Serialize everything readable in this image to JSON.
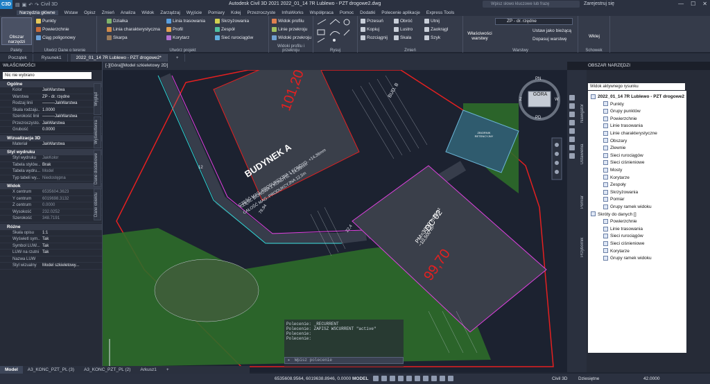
{
  "titlebar": {
    "app_icon_label": "C3D",
    "workspace": "Civil 3D",
    "title": "Autodesk Civil 3D 2021   2022_01_14 7R Lublewo - PZT drogowe2.dwg",
    "search_placeholder": "Wpisz słowo kluczowe lub frazę",
    "user": "Zarejestruj się",
    "min": "—",
    "max": "☐",
    "close": "✕"
  },
  "menu": [
    "Narzędzia główne",
    "Wstaw",
    "Opisz",
    "Zmień",
    "Analiza",
    "Widok",
    "Zarządzaj",
    "Wyjście",
    "Pomiary",
    "Kolej",
    "Przezroczyste",
    "InfraWorks",
    "Współpraca",
    "Pomoc",
    "Dodatki",
    "Polecenie aplikacje",
    "Express Tools"
  ],
  "ribbon": {
    "palettes": {
      "big": "Obszar narzędzi",
      "label": "Palety"
    },
    "ground": {
      "items": [
        "Punkty",
        "Powierzchnie",
        "Ciąg poligonowy"
      ],
      "label": "Utwórz Dane o terenie"
    },
    "design": {
      "items": [
        "Działka",
        "Linia charakterystyczna",
        "Skarpa",
        "Linia trasowania",
        "Profil",
        "Korytarz",
        "Skrzyżowania",
        "Zespół",
        "Sieć rurociągów"
      ],
      "label": "Utwórz projekt"
    },
    "profile": {
      "items": [
        "Widok profilu",
        "Linie przekroju",
        "Widoki przekroju"
      ],
      "label": "Widoki profilu i przekroju"
    },
    "draw": {
      "label": "Rysuj"
    },
    "modify": {
      "items": [
        "Przesuń",
        "Kopiuj",
        "Rozciągnij",
        "Obróć",
        "Lustro",
        "Skala",
        "Utnij",
        "Zaokrągl",
        "Szyk"
      ],
      "label": "Zmień"
    },
    "layers": {
      "big": "Właściwości warstwy",
      "current_layer": "ZP - dr. rzędne",
      "items": [
        "Ustaw jako bieżącą",
        "Dopasuj warstwę"
      ],
      "label": "Warstwy"
    },
    "clipboard": {
      "big": "Wklej",
      "label": "Schowek"
    }
  },
  "doc_tabs": [
    "Początek",
    "Rysunek1",
    "2022_01_14 7R Lublewo - PZT drogowe2*"
  ],
  "doc_tab_add": "+",
  "properties": {
    "title": "WŁAŚCIWOŚCI",
    "selection": "Nic nie wybrano",
    "sections": [
      {
        "name": "Ogólne",
        "rows": [
          [
            "Kolor",
            "JakWarstwa",
            false
          ],
          [
            "Warstwa",
            "ZP - dr. rzędne",
            false
          ],
          [
            "Rodzaj linii",
            "———JakWarstwa",
            false
          ],
          [
            "Skala rodzaju...",
            "1.0000",
            false
          ],
          [
            "Szerokość linii",
            "———JakWarstwa",
            false
          ],
          [
            "Przezroczysto...",
            "JakWarstwa",
            false
          ],
          [
            "Grubość",
            "0.0000",
            false
          ]
        ]
      },
      {
        "name": "Wizualizacja 3D",
        "rows": [
          [
            "Materiał",
            "JakWarstwa",
            false
          ]
        ]
      },
      {
        "name": "Styl wydruku",
        "rows": [
          [
            "Styl wydruku",
            "JakKolor",
            true
          ],
          [
            "Tabela stylów...",
            "Brak",
            false
          ],
          [
            "Tabela wydru...",
            "Model",
            true
          ],
          [
            "Typ tabeli wy...",
            "Niedostępna",
            true
          ]
        ]
      },
      {
        "name": "Widok",
        "rows": [
          [
            "X centrum",
            "6535604.3623",
            true
          ],
          [
            "Y centrum",
            "6019698.3132",
            true
          ],
          [
            "Z centrum",
            "0.0000",
            true
          ],
          [
            "Wysokość",
            "232.0252",
            true
          ],
          [
            "Szerokość",
            "348.7191",
            true
          ]
        ]
      },
      {
        "name": "Różne",
        "rows": [
          [
            "Skala opisu",
            "1:1",
            false
          ],
          [
            "Wyświetl sym...",
            "Tak",
            false
          ],
          [
            "Symbol LUW...",
            "Tak",
            false
          ],
          [
            "LUW na rzutni",
            "Tak",
            false
          ],
          [
            "Nazwa LUW",
            "",
            false
          ],
          [
            "Styl wizualny",
            "Model szkieletowy...",
            false
          ]
        ]
      }
    ],
    "side_tabs": [
      "Wygląd",
      "Wyświetlenia",
      "Dane dodatkowe",
      "Dane obiektu"
    ]
  },
  "viewport": {
    "title": "[-][Góra][Model szkieletowy 2D]",
    "viewcube": {
      "top": "GÓRA",
      "n": "PN",
      "s": "PD",
      "e": "W",
      "w": "Z"
    },
    "labels": {
      "building_a": "BUDYNEK A",
      "level_a": "101,20",
      "building_a_desc1": "CZĘŚĆ MAG.-PRODUKCYJNA 1 KONDYG. +14,36mm",
      "building_a_desc2": "CZĘŚĆ BIUROWA 2 KONDYG. +14,36mm",
      "building_a_desc3": "CAŁOŚĆ MAG.-PRODUKCYJNA 12,5m",
      "bud_b": "BUD. B",
      "dc02": "DC 02",
      "dc02_pm": "PM=3000 m3/m²",
      "dc02_h": "~10,500 m²",
      "level_dc": "99,70",
      "tank": "ZBIORNIK RETENCYJNY",
      "dim1": "22,4",
      "dim2": "78,94",
      "dim3": "12"
    }
  },
  "command": {
    "history": [
      "Polecenie: _RECURRENT",
      "Polecenie: ZAPISZ  WSCURRENT \"active\"",
      "Polecenie:",
      "Polecenie:"
    ],
    "placeholder": "Wpisz polecenie",
    "prompt_icon": "▸"
  },
  "toolspace": {
    "title": "OBSZAR NARZĘDZI",
    "view_selector": "Widok aktywnego rysunku",
    "side_tabs": [
      "Nawigator",
      "Ustawienia",
      "Pomiar",
      "Przybornik"
    ],
    "tree": [
      {
        "label": "2022_01_14 7R Lublewo - PZT drogowe2",
        "level": 0,
        "root": true
      },
      {
        "label": "Punkty",
        "level": 1
      },
      {
        "label": "Grupy punktów",
        "level": 1
      },
      {
        "label": "Powierzchnie",
        "level": 1
      },
      {
        "label": "Linie trasowania",
        "level": 1
      },
      {
        "label": "Linie charakterystyczne",
        "level": 1
      },
      {
        "label": "Obszary",
        "level": 1
      },
      {
        "label": "Zlewnie",
        "level": 1
      },
      {
        "label": "Sieci rurociągów",
        "level": 1
      },
      {
        "label": "Sieci ciśnieniowe",
        "level": 1
      },
      {
        "label": "Mosty",
        "level": 1
      },
      {
        "label": "Korytarze",
        "level": 1
      },
      {
        "label": "Zespoły",
        "level": 1
      },
      {
        "label": "Skrzyżowania",
        "level": 1
      },
      {
        "label": "Pomiar",
        "level": 1
      },
      {
        "label": "Grupy ramek widoku",
        "level": 1
      },
      {
        "label": "Skróty do danych []",
        "level": 0
      },
      {
        "label": "Powierzchnie",
        "level": 1
      },
      {
        "label": "Linie trasowania",
        "level": 1
      },
      {
        "label": "Sieci rurociągów",
        "level": 1
      },
      {
        "label": "Sieci ciśnieniowe",
        "level": 1
      },
      {
        "label": "Korytarze",
        "level": 1
      },
      {
        "label": "Grupy ramek widoku",
        "level": 1
      }
    ]
  },
  "layout_tabs": [
    "Model",
    "A3_KONC_PZT_PL (3)",
    "A3_KONC_PZT_PL (2)",
    "Arkusz1",
    "+"
  ],
  "status": {
    "coords": "6535608.9564, 6019638.8946, 0.0000",
    "space": "MODEL",
    "workspace": "Civil 3D",
    "scale": "Dziesiętne",
    "zoom": "42.0000"
  },
  "colors": {
    "bg": "#1c2230",
    "panel": "#262b37",
    "ribbon": "#353b4a",
    "red": "#e52020",
    "green": "#2e6b2a",
    "magenta": "#e040e0",
    "cyan": "#2fd6d6"
  }
}
